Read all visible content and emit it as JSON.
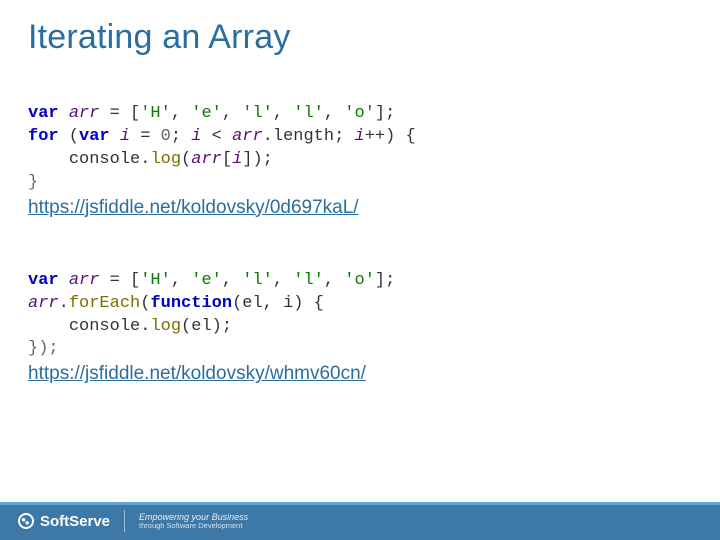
{
  "title": "Iterating an Array",
  "code1": {
    "l1": {
      "kw1": "var",
      "id1": "arr",
      "mid": " = [",
      "s1": "'H'",
      "c1": ", ",
      "s2": "'e'",
      "c2": ", ",
      "s3": "'l'",
      "c3": ", ",
      "s4": "'l'",
      "c4": ", ",
      "s5": "'o'",
      "end": "];"
    },
    "l2": {
      "kw1": "for",
      "p1": " (",
      "kw2": "var",
      "sp": " ",
      "id1": "i",
      "eq": " = ",
      "n0": "0",
      "sc": "; ",
      "id2": "i",
      "lt": " < ",
      "id3": "arr",
      "dot": ".",
      "len": "length",
      "sc2": "; ",
      "id4": "i",
      "inc": "++) {"
    },
    "l3": {
      "pad": "    ",
      "obj": "console",
      "dot": ".",
      "fn": "log",
      "op": "(",
      "id1": "arr",
      "br": "[",
      "id2": "i",
      "cl": "]);"
    },
    "l4": "}"
  },
  "link1": "https://jsfiddle.net/koldovsky/0d697kaL/",
  "code2": {
    "l1": {
      "kw1": "var",
      "id1": "arr",
      "mid": " = [",
      "s1": "'H'",
      "c1": ", ",
      "s2": "'e'",
      "c2": ", ",
      "s3": "'l'",
      "c3": ", ",
      "s4": "'l'",
      "c4": ", ",
      "s5": "'o'",
      "end": "];"
    },
    "l2": {
      "id1": "arr",
      "dot": ".",
      "fn": "forEach",
      "op": "(",
      "kw1": "function",
      "args": "(el, i) {"
    },
    "l3": {
      "pad": "    ",
      "obj": "console",
      "dot": ".",
      "fn": "log",
      "args": "(el);"
    },
    "l4": "});"
  },
  "link2": "https://jsfiddle.net/koldovsky/whmv60cn/",
  "footer": {
    "brand": "SoftServe",
    "tag1": "Empowering your Business",
    "tag2": "through Software Development"
  }
}
